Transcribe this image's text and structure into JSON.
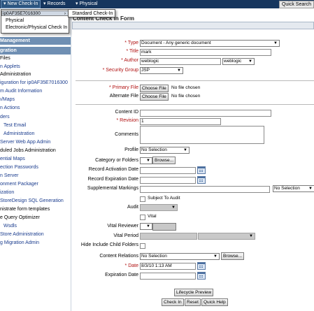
{
  "topbar": {
    "menus": [
      "New Check-In",
      "Records",
      "Physical"
    ],
    "quick_search": "Quick Search"
  },
  "dropdown": {
    "items": [
      "ip0AF35E7016300",
      "Physical",
      "Electronic/Physical Check In"
    ],
    "submenu": "Standard Check-In"
  },
  "sidebar": {
    "items_top": [
      "Files"
    ],
    "head1": "Management",
    "head2": "gration",
    "items": [
      "n Applets",
      "Administration",
      "iguration for ip0AF35E7016300",
      "m Audit Information",
      "ı/Maps",
      "n Actions",
      "ders",
      "Test Email",
      "Administration",
      "Server Web App Admin",
      "duled Jobs Administration",
      "ential Maps",
      "ection Passwords",
      "n Server",
      "onment Packager",
      "ization",
      "StoreDesign SQL Generation",
      "nistrate form templates",
      "e Query Optimizer",
      "Wsdls",
      "Store Administration",
      "g Migration Admin"
    ]
  },
  "form": {
    "title": "Content Check In Form",
    "type_label": "* Type",
    "type_value": "Document - Any generic document",
    "title_label": "* Title",
    "title_value": "mark",
    "author_label": "* Author",
    "author_value": "weblogic",
    "author_select": "weblogic",
    "security_label": "* Security Group",
    "security_value": "JSP",
    "primary_label": "* Primary File",
    "alternate_label": "Alternate File",
    "choose_file": "Choose File",
    "no_file": "No file chosen",
    "content_id_label": "Content ID",
    "revision_label": "* Revision",
    "revision_value": "1",
    "comments_label": "Comments",
    "profile_label": "Profile",
    "profile_value": "No Selection",
    "category_label": "Category or Folders",
    "browse": "Browse...",
    "activation_label": "Record Activation Date",
    "expiration_rec_label": "Record Expiration Date",
    "supp_label": "Supplemental Markings",
    "supp_select": "No Selection",
    "subject_audit": "Subject To Audit",
    "audit_label": "Audit",
    "vital": "Vital",
    "vital_reviewer_label": "Vital Reviewer",
    "vital_period_label": "Vital Period",
    "hide_label": "Hide Include Child Folders",
    "relations_label": "Content Relations",
    "relations_value": "No Selection",
    "date_label": "* Date",
    "date_value": "8/3/10 1:13 AM",
    "exp_label": "Expiration Date",
    "lifecycle": "Lifecycle Preview",
    "checkin": "Check In",
    "reset": "Reset",
    "help": "Quick Help"
  }
}
